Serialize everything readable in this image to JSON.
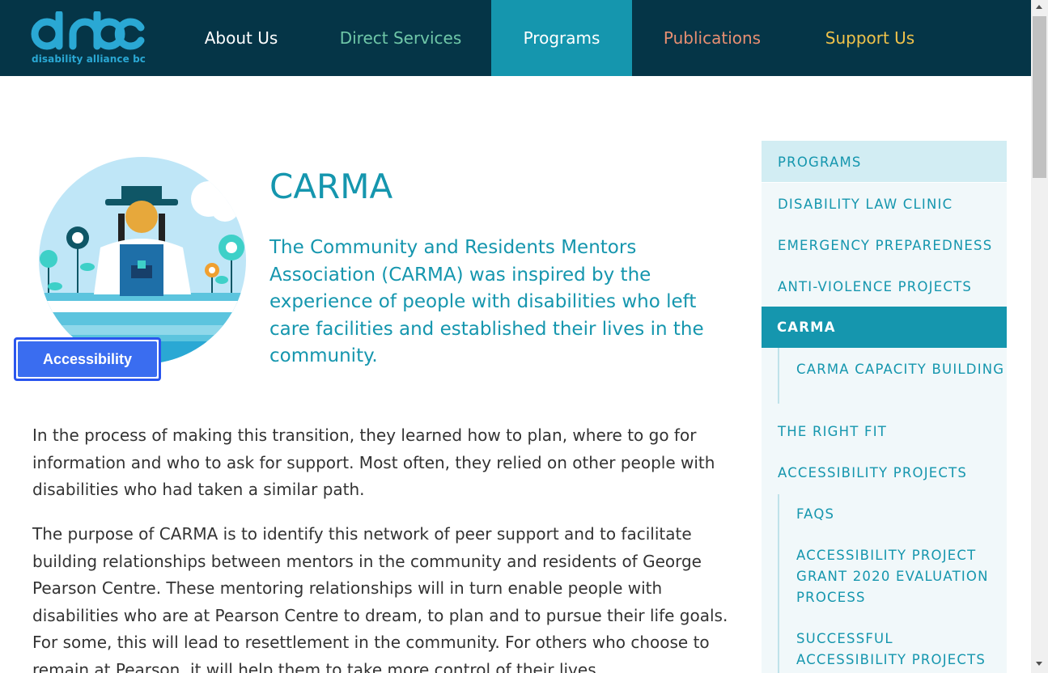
{
  "logo": {
    "mark": "dabc",
    "text": "disability alliance bc"
  },
  "nav": {
    "about": "About Us",
    "direct": "Direct Services",
    "programs": "Programs",
    "publications": "Publications",
    "support": "Support Us"
  },
  "hero": {
    "title": "CARMA",
    "intro": "The Community and Residents Mentors Association (CARMA) was inspired by the experience of people with disabilities who left care facilities and established their lives in the community."
  },
  "accessibility_button": "Accessibility",
  "body": {
    "para1": "In the process of making this transition, they learned how to plan, where to go for information and who to ask for support. Most often, they relied on other people with disabilities who had taken a similar path.",
    "para2": "The purpose of CARMA is to identify this network of peer support and to facilitate building relationships between mentors in the community and residents of George Pearson Centre. These mentoring relationships will in turn enable people with disabilities who are at Pearson Centre to dream, to plan and to pursue their life goals. For some, this will lead to resettlement in the community. For others who choose to remain at Pearson, it will help them to take more control of their lives."
  },
  "sidebar": {
    "heading": "PROGRAMS",
    "items": [
      "DISABILITY LAW CLINIC",
      "EMERGENCY PREPAREDNESS",
      "ANTI-VIOLENCE PROJECTS",
      "CARMA",
      "CARMA CAPACITY BUILDING",
      "THE RIGHT FIT",
      "ACCESSIBILITY PROJECTS",
      "FAQS",
      "ACCESSIBILITY PROJECT GRANT 2020 EVALUATION PROCESS",
      "SUCCESSFUL ACCESSIBILITY PROJECTS"
    ]
  },
  "colors": {
    "header_bg": "#053547",
    "accent": "#1596ae",
    "direct_services": "#6fc7a8",
    "publications": "#e88f72",
    "support": "#f0c24a",
    "accessibility_button": "#3a6df0"
  }
}
